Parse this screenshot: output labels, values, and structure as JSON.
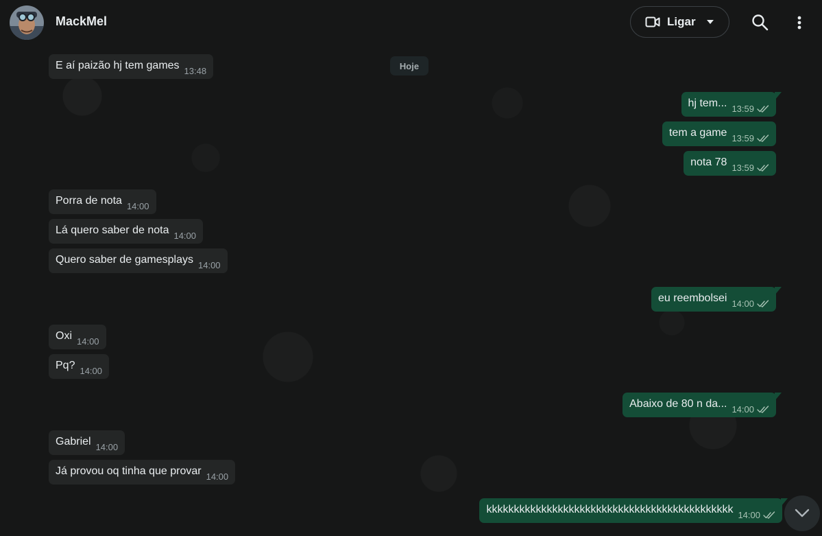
{
  "header": {
    "contact_name": "MackMel",
    "call_label": "Ligar",
    "icons": [
      "video-icon",
      "caret-down-icon",
      "search-icon",
      "menu-dots-icon"
    ]
  },
  "date_chip": "Hoje",
  "messages": [
    {
      "direction": "in",
      "text": "E aí paizão hj tem games",
      "time": "13:48"
    },
    {
      "direction": "out",
      "text": "hj tem...",
      "time": "13:59",
      "status": "read"
    },
    {
      "direction": "out",
      "text": "tem a game",
      "time": "13:59",
      "status": "read"
    },
    {
      "direction": "out",
      "text": "nota 78",
      "time": "13:59",
      "status": "read"
    },
    {
      "direction": "in",
      "text": "Porra de nota",
      "time": "14:00"
    },
    {
      "direction": "in",
      "text": "Lá quero saber de nota",
      "time": "14:00"
    },
    {
      "direction": "in",
      "text": "Quero saber de gamesplays",
      "time": "14:00"
    },
    {
      "direction": "out",
      "text": "eu reembolsei",
      "time": "14:00",
      "status": "read"
    },
    {
      "direction": "in",
      "text": "Oxi",
      "time": "14:00"
    },
    {
      "direction": "in",
      "text": "Pq?",
      "time": "14:00"
    },
    {
      "direction": "out",
      "text": "Abaixo de 80 n da...",
      "time": "14:00",
      "status": "read"
    },
    {
      "direction": "in",
      "text": "Gabriel",
      "time": "14:00"
    },
    {
      "direction": "in",
      "text": "Já provou oq tinha que provar",
      "time": "14:00"
    },
    {
      "direction": "out",
      "text": "kkkkkkkkkkkkkkkkkkkkkkkkkkkkkkkkkkkkkkkkkkkkk",
      "time": "14:00",
      "status": "read"
    }
  ],
  "colors": {
    "background": "#161717",
    "incoming_bubble": "#242626",
    "outgoing_bubble": "#144d37",
    "text": "#e9edef"
  }
}
